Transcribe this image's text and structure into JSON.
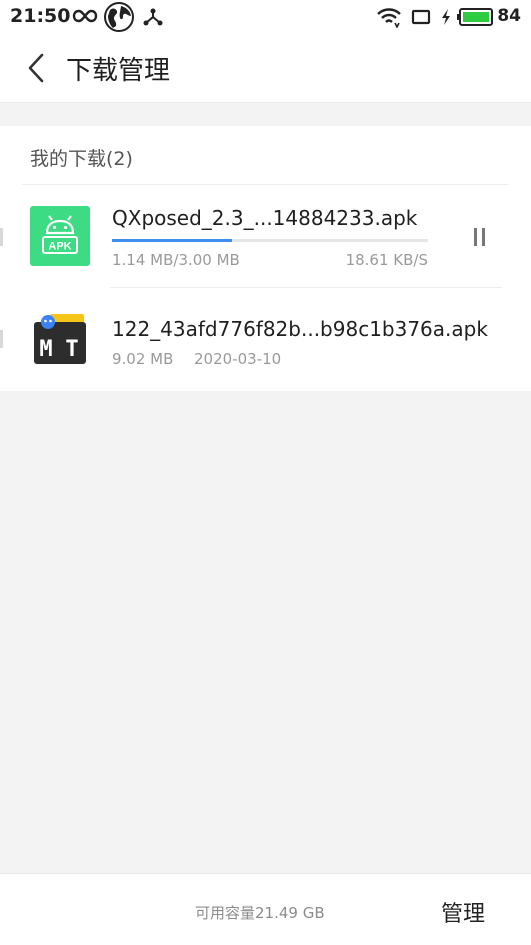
{
  "status_bar": {
    "time": "21:50",
    "battery": "84",
    "icons": [
      "infinity-icon",
      "globe-icon",
      "usb-tether-icon",
      "wifi-icon",
      "screen-icon",
      "charging-icon",
      "battery-icon"
    ]
  },
  "header": {
    "title": "下载管理",
    "back_icon": "chevron-left-icon"
  },
  "section": {
    "title": "我的下载(2)"
  },
  "downloads": [
    {
      "name": "QXposed_2.3_...14884233.apk",
      "progress_text": "1.14 MB/3.00 MB",
      "progress": 0.38,
      "speed": "18.61 KB/S",
      "icon": "android-apk-icon",
      "action_icon": "pause-icon"
    },
    {
      "name": "122_43afd776f82b...b98c1b376a.apk",
      "size": "9.02 MB",
      "date": "2020-03-10",
      "icon": "mt-manager-icon"
    }
  ],
  "footer": {
    "storage": "可用容量21.49 GB",
    "manage_label": "管理"
  },
  "colors": {
    "accent": "#3f8ef0",
    "apk_green": "#3ddc84",
    "battery_green": "#2ecc40"
  }
}
